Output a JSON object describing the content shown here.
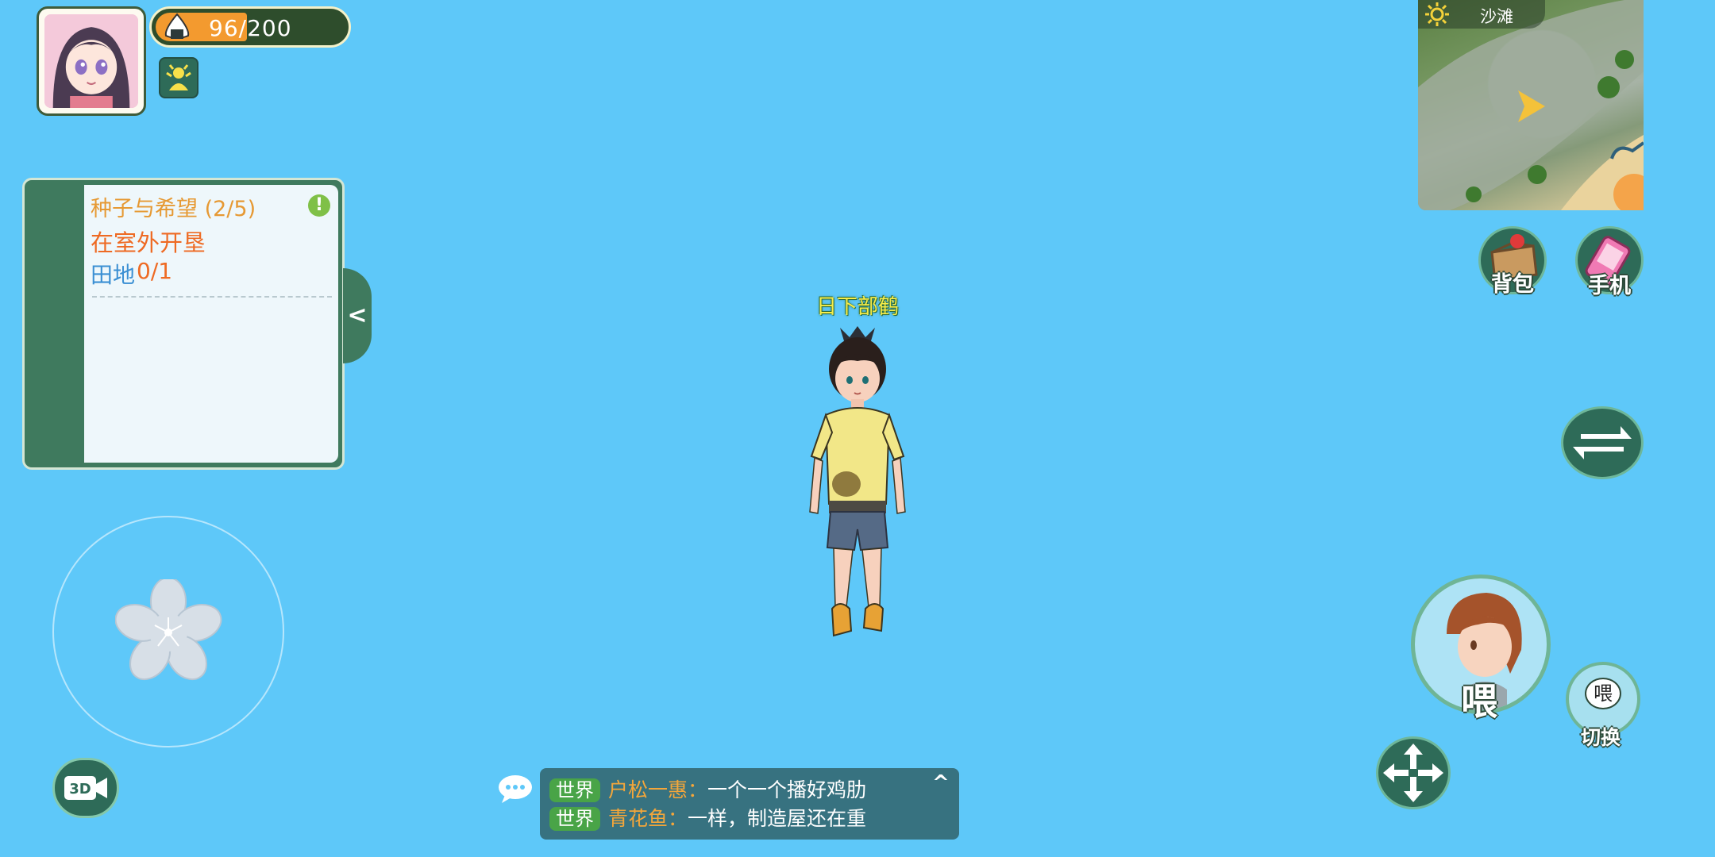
{
  "player": {
    "stamina_current": "96",
    "stamina_max": "/200",
    "name": "日下部鹤"
  },
  "quest": {
    "title": "种子与希望 (2/5)",
    "step": "在室外开垦",
    "target_label": "田地",
    "target_progress": "0/1",
    "alert_glyph": "!",
    "collapse_glyph": "<"
  },
  "minimap": {
    "area_name": "沙滩"
  },
  "buttons": {
    "backpack_label": "背包",
    "phone_label": "手机",
    "talk_label": "喂",
    "switch_talk_bubble": "喂",
    "switch_talk_label": "切换",
    "camera_label": "3D"
  },
  "chat": {
    "expand_glyph": "^",
    "messages": [
      {
        "channel": "世界",
        "sender": "户松一惠：",
        "text": "一个一个播好鸡肋"
      },
      {
        "channel": "世界",
        "sender": "青花鱼：",
        "text": "一样，制造屋还在重"
      }
    ]
  },
  "colors": {
    "sky": "#5ec8f9",
    "panel_green": "#3f7a5e",
    "quest_orange": "#ee6a23",
    "quest_blue": "#3a8fd3",
    "name_yellow": "#f7ed4a"
  }
}
